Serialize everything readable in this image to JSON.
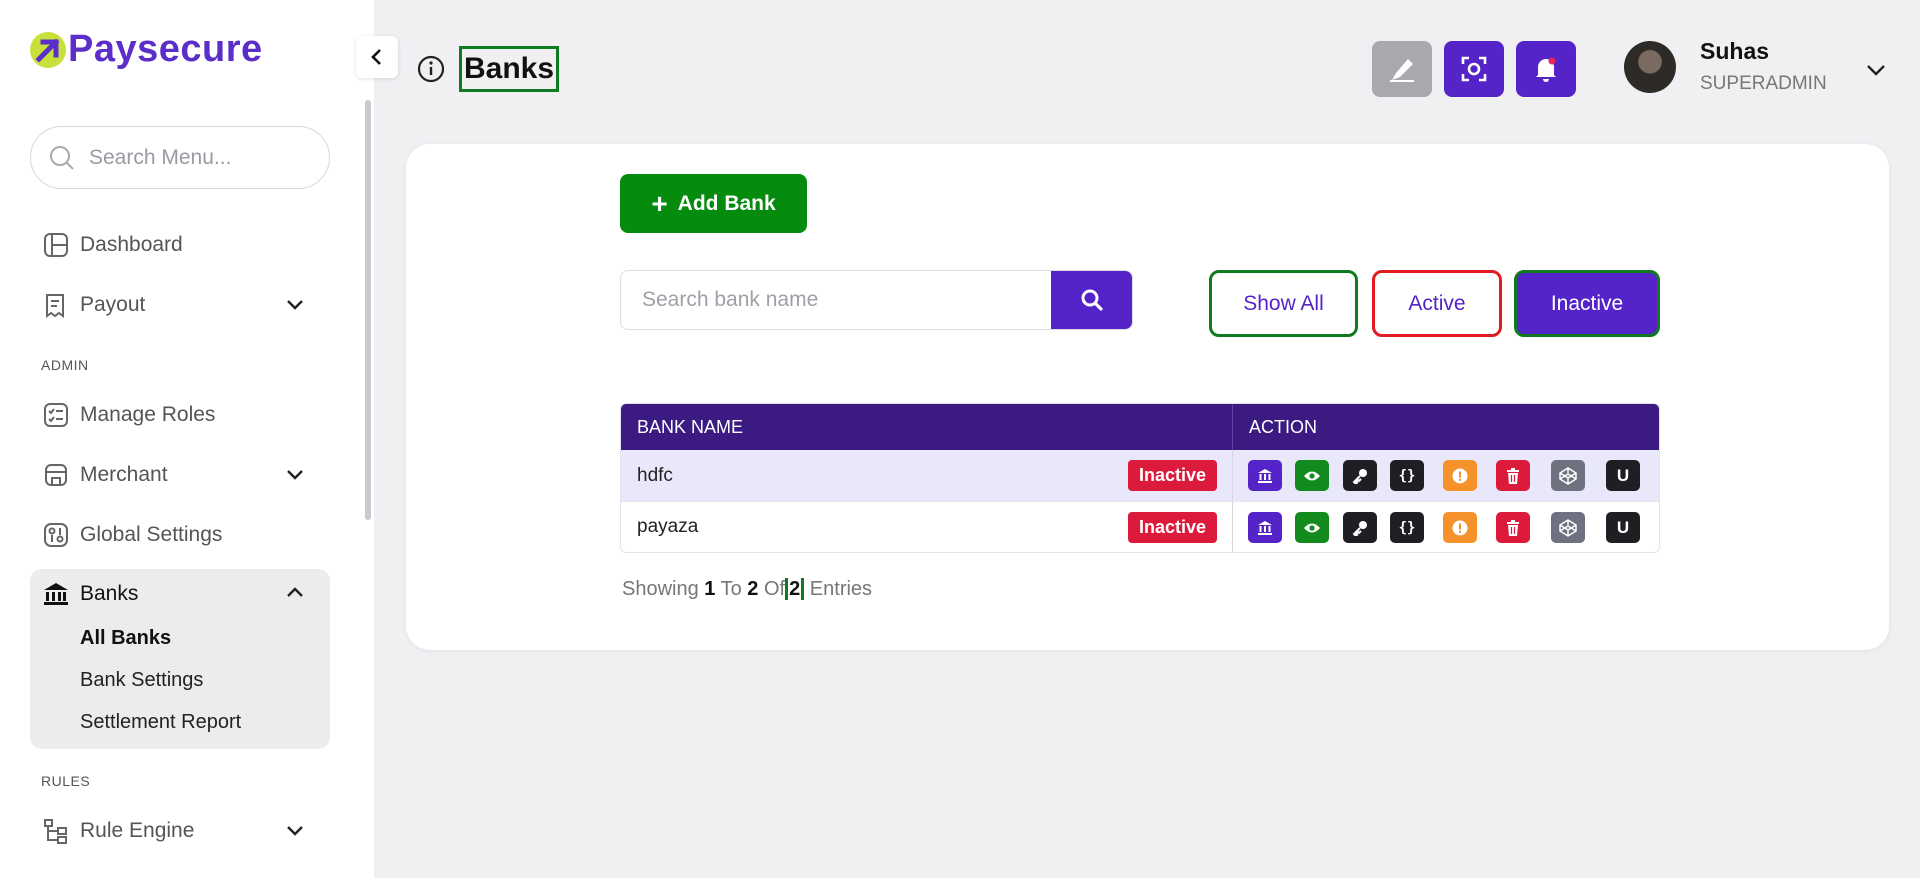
{
  "brand": {
    "name": "Paysecure",
    "accent": "#5b2ec9",
    "mark_color": "#c8e03a"
  },
  "sidebar": {
    "search_placeholder": "Search Menu...",
    "items": [
      {
        "label": "Dashboard",
        "icon": "dashboard-icon",
        "has_chevron": false
      },
      {
        "label": "Payout",
        "icon": "receipt-icon",
        "has_chevron": true
      }
    ],
    "admin_label": "ADMIN",
    "admin_items": [
      {
        "label": "Manage Roles",
        "icon": "roles-icon",
        "has_chevron": false
      },
      {
        "label": "Merchant",
        "icon": "store-icon",
        "has_chevron": true
      },
      {
        "label": "Global Settings",
        "icon": "settings-sliders-icon",
        "has_chevron": false
      }
    ],
    "banks": {
      "label": "Banks",
      "icon": "bank-icon",
      "expanded": true,
      "children": [
        {
          "label": "All Banks",
          "active": true
        },
        {
          "label": "Bank Settings",
          "active": false
        },
        {
          "label": "Settlement Report",
          "active": false
        }
      ]
    },
    "rules_label": "RULES",
    "rules_items": [
      {
        "label": "Rule Engine",
        "icon": "rule-tree-icon",
        "has_chevron": true
      }
    ]
  },
  "header": {
    "title": "Banks",
    "user": {
      "name": "Suhas",
      "role": "SUPERADMIN"
    }
  },
  "main": {
    "add_button": "Add Bank",
    "search_placeholder": "Search bank name",
    "filters": [
      {
        "label": "Show All",
        "border": "#0f7a1f",
        "bg": "#ffffff",
        "color": "#5424c8"
      },
      {
        "label": "Active",
        "border": "#e01b22",
        "bg": "#ffffff",
        "color": "#5424c8"
      },
      {
        "label": "Inactive",
        "border": "#0f7a1f",
        "bg": "#5424c8",
        "color": "#ffffff"
      }
    ],
    "table": {
      "columns": [
        "BANK NAME",
        "ACTION"
      ],
      "rows": [
        {
          "name": "hdfc",
          "status": "Inactive",
          "highlighted": true
        },
        {
          "name": "payaza",
          "status": "Inactive",
          "highlighted": false
        }
      ],
      "actions": [
        {
          "icon": "bank-icon",
          "color": "#5424c8"
        },
        {
          "icon": "eye-icon",
          "color": "#138a1e"
        },
        {
          "icon": "key-icon",
          "color": "#1f1f23"
        },
        {
          "icon": "code-braces-icon",
          "color": "#1f1f23",
          "text": "{}"
        },
        {
          "icon": "alert-icon",
          "color": "#f5922a"
        },
        {
          "icon": "trash-icon",
          "color": "#dc1a3c"
        },
        {
          "icon": "codepen-icon",
          "color": "#6e7280"
        },
        {
          "icon": "u-letter-icon",
          "color": "#1f1f23",
          "text": "U"
        }
      ]
    },
    "footer": {
      "prefix": "Showing",
      "from": "1",
      "to_word": "To",
      "to": "2",
      "of_word": "Of",
      "total": "2",
      "suffix": "Entries"
    }
  }
}
